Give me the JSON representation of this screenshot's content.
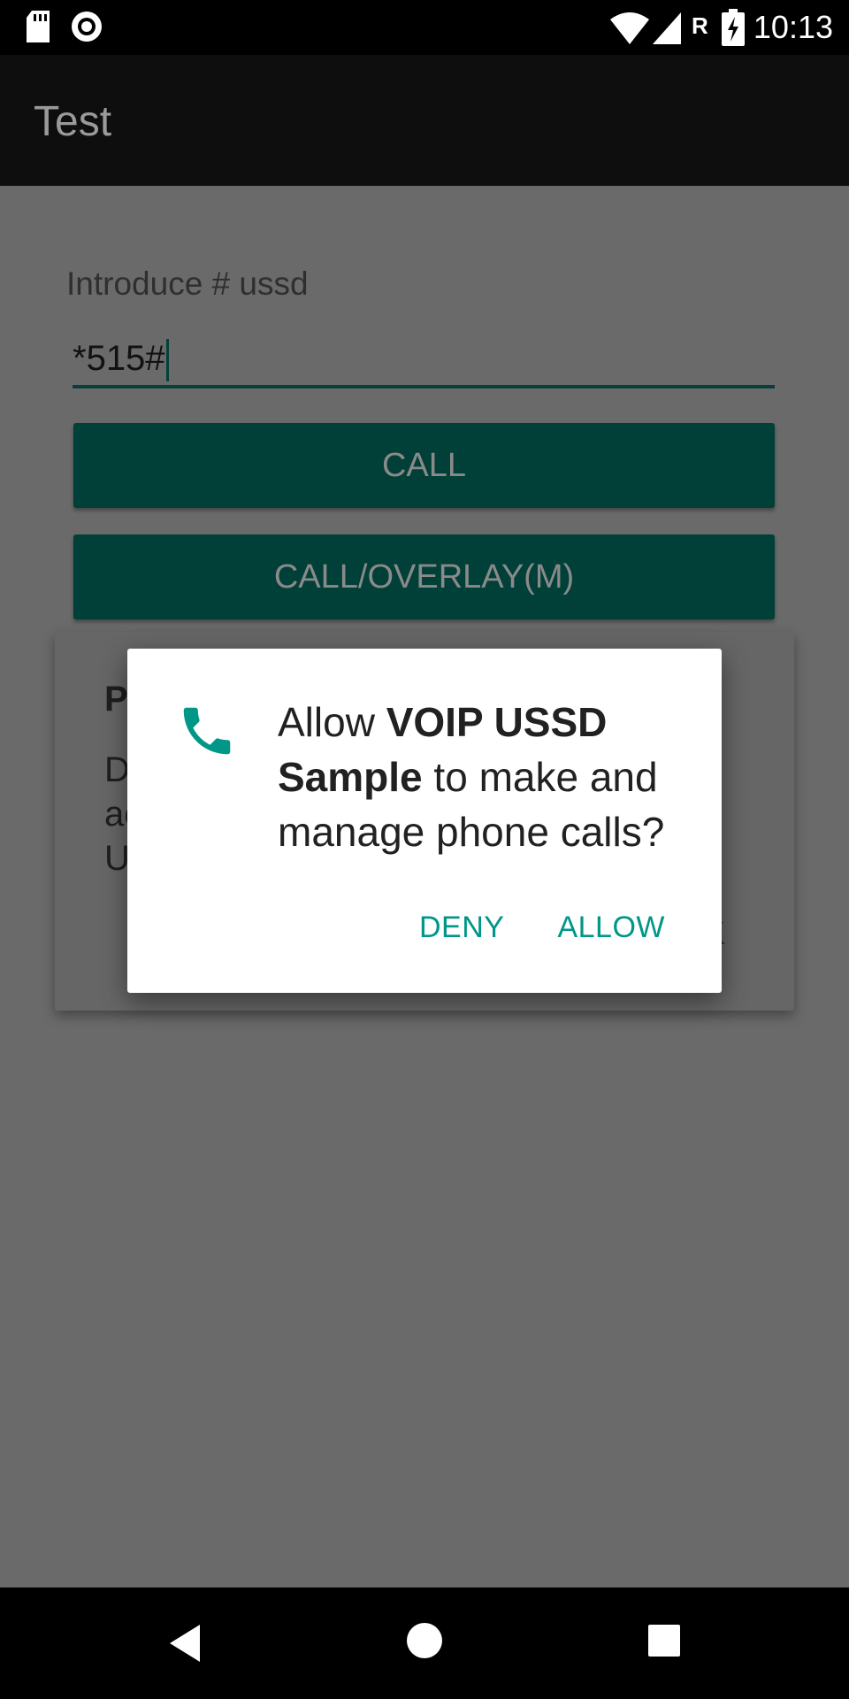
{
  "status_bar": {
    "time": "10:13",
    "icons": [
      "sd-card-icon",
      "record-icon",
      "wifi-icon",
      "signal-icon",
      "roaming-icon",
      "battery-charging-icon"
    ],
    "roaming_label": "R"
  },
  "app_bar": {
    "title": "Test"
  },
  "form": {
    "label": "Introduce # ussd",
    "input_value": "*515#"
  },
  "buttons": {
    "call": "CALL",
    "call_overlay": "CALL/OVERLAY(M)"
  },
  "background_dialog": {
    "line1": "P",
    "line2": "D",
    "line3": "ac",
    "line4": "U",
    "trailing": "K"
  },
  "permission_dialog": {
    "text_prefix": "Allow ",
    "app_name_part1": "VOIP USSD",
    "app_name_part2": "Sample",
    "text_suffix": " to make and manage phone calls?",
    "deny": "DENY",
    "allow": "ALLOW",
    "accent_color": "#009688"
  },
  "nav_bar": {
    "buttons": [
      "back-icon",
      "home-icon",
      "recents-icon"
    ]
  }
}
